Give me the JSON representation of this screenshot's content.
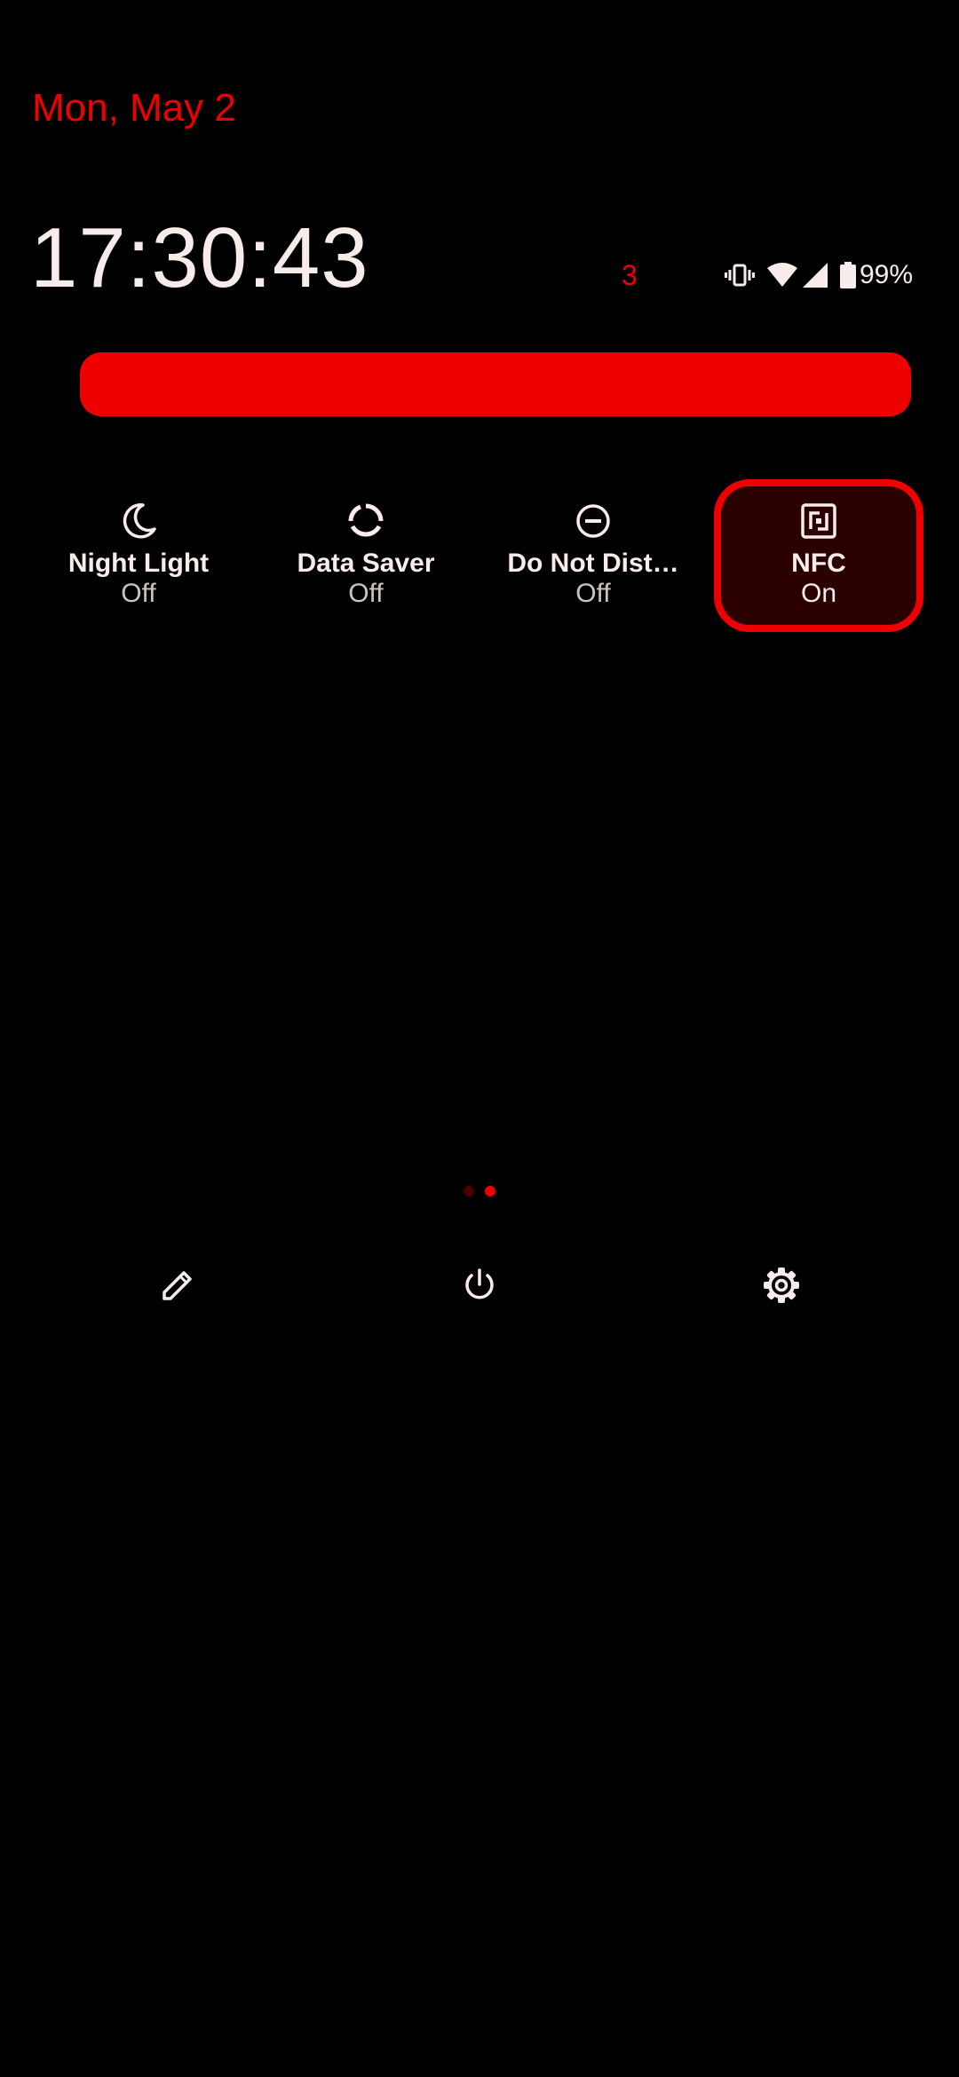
{
  "header": {
    "date": "Mon, May 2",
    "time": "17:30:43",
    "notification_count": "3"
  },
  "status_bar": {
    "icons": [
      "vibrate-icon",
      "wifi-icon",
      "cellular-signal-icon",
      "battery-icon"
    ],
    "battery_text": "99%"
  },
  "brightness": {
    "level": 1.0,
    "color": "#ef0000"
  },
  "tiles": [
    {
      "label": "Night Light",
      "state": "Off",
      "icon": "moon-icon",
      "active": false
    },
    {
      "label": "Data Saver",
      "state": "Off",
      "icon": "data-saver-icon",
      "active": false
    },
    {
      "label": "Do Not Dist…",
      "state": "Off",
      "icon": "do-not-disturb-icon",
      "active": false
    },
    {
      "label": "NFC",
      "state": "On",
      "icon": "nfc-icon",
      "active": true
    }
  ],
  "pager": {
    "pages": 2,
    "current": 2
  },
  "footer": {
    "buttons": [
      "edit-icon",
      "power-icon",
      "settings-icon"
    ]
  },
  "colors": {
    "accent": "#ef0000",
    "background": "#000000",
    "text": "#f7ecea",
    "inactive_dot": "#4a0000"
  }
}
